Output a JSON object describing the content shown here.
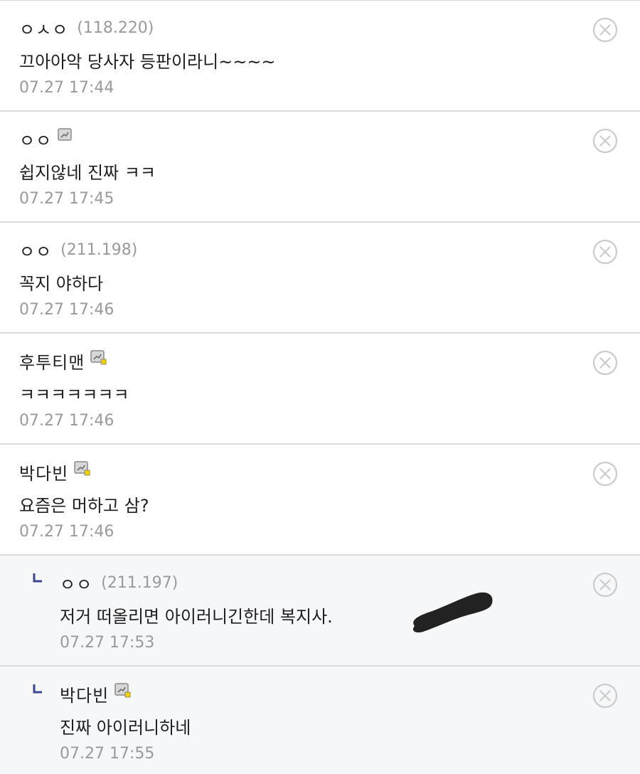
{
  "comments": [
    {
      "nick": "ㅇㅅㅇ",
      "ip": "(118.220)",
      "badge": "none",
      "text": "끄아아악 당사자 등판이라니~~~~",
      "time": "07.27 17:44",
      "reply": false
    },
    {
      "nick": "ㅇㅇ",
      "ip": "",
      "badge": "gallog-icon",
      "text": "쉽지않네 진짜 ㅋㅋ",
      "time": "07.27 17:45",
      "reply": false
    },
    {
      "nick": "ㅇㅇ",
      "ip": "(211.198)",
      "badge": "none",
      "text": "꼭지 야하다",
      "time": "07.27 17:46",
      "reply": false
    },
    {
      "nick": "후투티맨",
      "ip": "",
      "badge": "fixed-nick-icon",
      "text": "ㅋㅋㅋㅋㅋㅋㅋ",
      "time": "07.27 17:46",
      "reply": false
    },
    {
      "nick": "박다빈",
      "ip": "",
      "badge": "fixed-nick-icon",
      "text": "요즘은 머하고 삼?",
      "time": "07.27 17:46",
      "reply": false
    },
    {
      "nick": "ㅇㅇ",
      "ip": "(211.197)",
      "badge": "none",
      "text": "저거 떠올리면 아이러니긴한데 복지사.",
      "time": "07.27 17:53",
      "reply": true
    },
    {
      "nick": "박다빈",
      "ip": "",
      "badge": "fixed-nick-icon",
      "text": "진짜 아이러니하네",
      "time": "07.27 17:55",
      "reply": true
    }
  ],
  "colors": {
    "reply_background": "#f6f7f9",
    "reply_marker": "#3b4890",
    "delete_icon": "#cccccc",
    "meta_text": "#9a9a9a",
    "fixed_nick_badge_dot": "#f2d300"
  },
  "icons": {
    "delete": "close-circle-icon",
    "reply": "reply-arrow-icon",
    "redaction": "black-marker-scribble"
  }
}
